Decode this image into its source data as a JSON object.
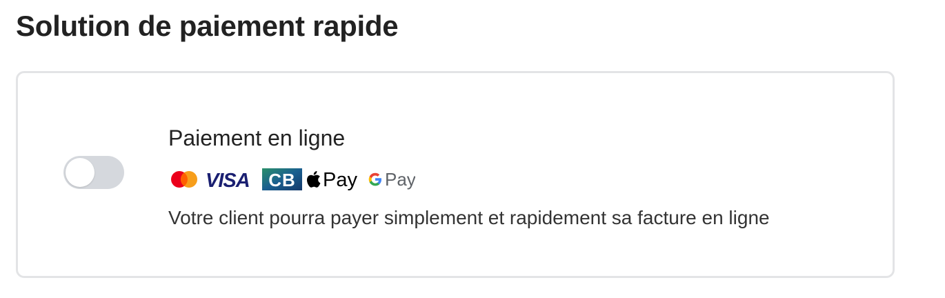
{
  "section": {
    "title": "Solution de paiement rapide"
  },
  "online_payment": {
    "title": "Paiement en ligne",
    "description": "Votre client pourra payer simplement et rapidement sa facture en ligne",
    "toggle_enabled": false,
    "toggle_color_off": "#d5d8dd"
  },
  "payment_logos": {
    "mastercard": {
      "icon": "mastercard-icon",
      "colors": [
        "#eb001b",
        "#f79e1b"
      ]
    },
    "visa": {
      "label": "VISA",
      "color": "#1a1f71"
    },
    "cb": {
      "label": "CB",
      "icon": "cb-icon",
      "colors": [
        "#1a5f8f",
        "#2a8f6a"
      ]
    },
    "apple_pay": {
      "label": "Pay",
      "icon": "apple-icon",
      "color": "#000000"
    },
    "google_pay": {
      "label": "Pay",
      "icon": "google-g-icon",
      "colors": [
        "#4285f4",
        "#ea4335",
        "#fbbc05",
        "#34a853"
      ]
    }
  }
}
